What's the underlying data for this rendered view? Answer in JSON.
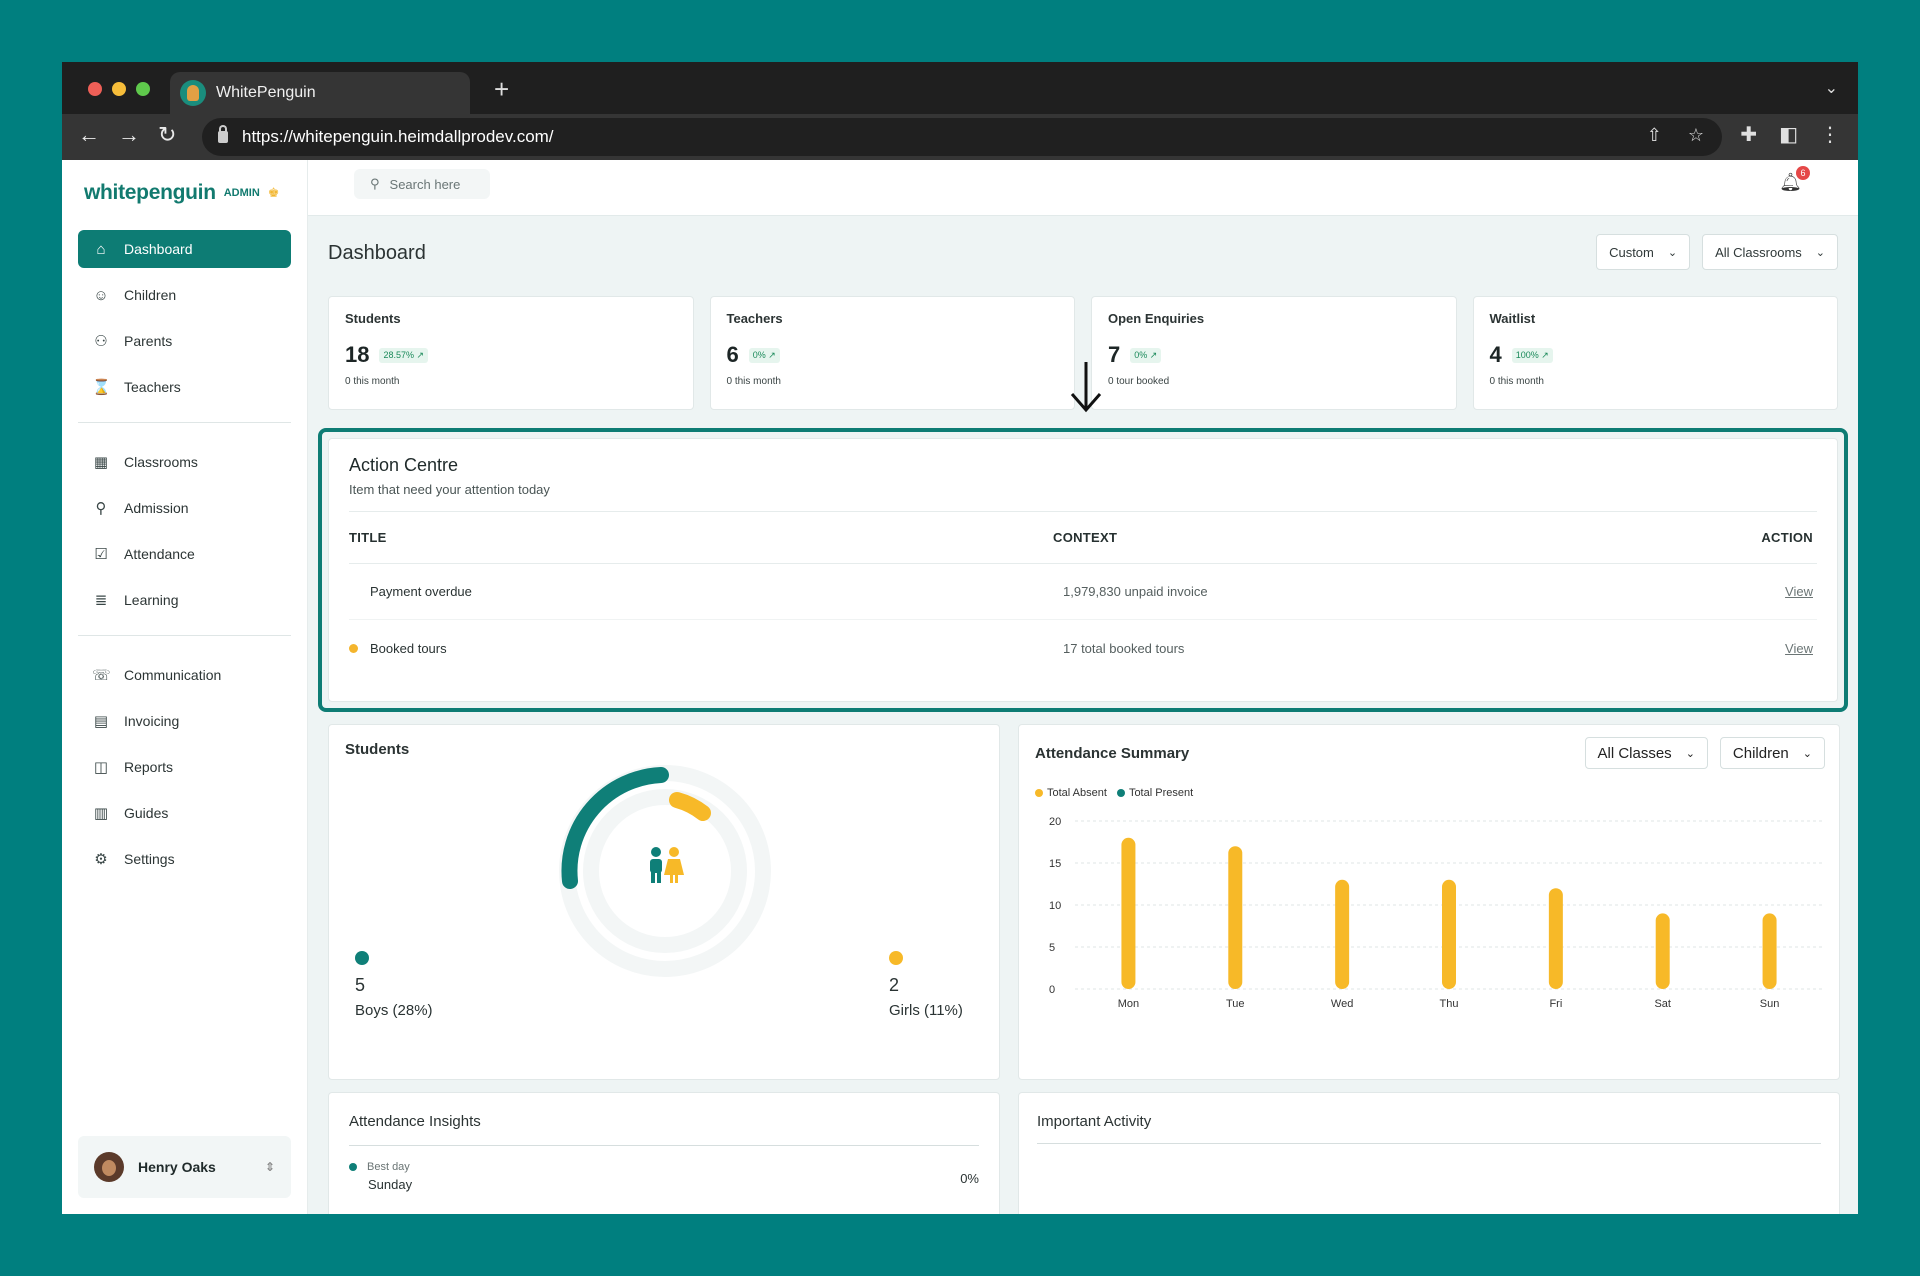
{
  "browser": {
    "tab_title": "WhitePenguin",
    "url": "https://whitepenguin.heimdallprodev.com/"
  },
  "brand": {
    "name": "whitepenguin",
    "role": "ADMIN"
  },
  "sidebar": {
    "groups": [
      [
        {
          "label": "Dashboard",
          "icon": "home-icon",
          "active": true
        },
        {
          "label": "Children",
          "icon": "child-icon"
        },
        {
          "label": "Parents",
          "icon": "parents-icon"
        },
        {
          "label": "Teachers",
          "icon": "teacher-icon"
        }
      ],
      [
        {
          "label": "Classrooms",
          "icon": "grid-icon"
        },
        {
          "label": "Admission",
          "icon": "admission-icon"
        },
        {
          "label": "Attendance",
          "icon": "check-icon"
        },
        {
          "label": "Learning",
          "icon": "learning-icon"
        }
      ],
      [
        {
          "label": "Communication",
          "icon": "chat-icon"
        },
        {
          "label": "Invoicing",
          "icon": "invoice-icon"
        },
        {
          "label": "Reports",
          "icon": "reports-icon"
        },
        {
          "label": "Guides",
          "icon": "guides-icon"
        },
        {
          "label": "Settings",
          "icon": "gear-icon"
        }
      ]
    ],
    "user": {
      "name": "Henry Oaks"
    }
  },
  "topbar": {
    "search_placeholder": "Search here",
    "notifications": "6"
  },
  "page": {
    "title": "Dashboard",
    "filters": {
      "period": "Custom",
      "classrooms": "All Classrooms"
    }
  },
  "stats": [
    {
      "label": "Students",
      "value": "18",
      "change": "28.57% ↗",
      "sub": "0 this month"
    },
    {
      "label": "Teachers",
      "value": "6",
      "change": "0% ↗",
      "sub": "0 this month"
    },
    {
      "label": "Open Enquiries",
      "value": "7",
      "change": "0% ↗",
      "sub": "0 tour booked"
    },
    {
      "label": "Waitlist",
      "value": "4",
      "change": "100% ↗",
      "sub": "0 this month"
    }
  ],
  "action_centre": {
    "title": "Action Centre",
    "subtitle": "Item that need your attention today",
    "columns": [
      "TITLE",
      "CONTEXT",
      "ACTION"
    ],
    "rows": [
      {
        "title": "Payment overdue",
        "context": "1,979,830 unpaid invoice",
        "action": "View",
        "dot": ""
      },
      {
        "title": "Booked tours",
        "context": "17 total booked tours",
        "action": "View",
        "dot": "#f4b52d"
      }
    ]
  },
  "students_card": {
    "title": "Students",
    "boys": {
      "value": "5",
      "label": "Boys (28%)"
    },
    "girls": {
      "value": "2",
      "label": "Girls (11%)"
    }
  },
  "attendance": {
    "title": "Attendance Summary",
    "filter_class": "All Classes",
    "filter_type": "Children",
    "legend_absent": "Total Absent",
    "legend_present": "Total Present"
  },
  "chart_data": {
    "type": "bar",
    "categories": [
      "Mon",
      "Tue",
      "Wed",
      "Thu",
      "Fri",
      "Sat",
      "Sun"
    ],
    "series": [
      {
        "name": "Total Absent",
        "values": [
          18,
          17,
          13,
          13,
          12,
          9,
          9
        ],
        "color": "#f7b928"
      },
      {
        "name": "Total Present",
        "values": [
          0,
          0,
          0,
          0,
          0,
          0,
          0
        ],
        "color": "#0f7f78"
      }
    ],
    "ylim": [
      0,
      20
    ],
    "yticks": [
      0,
      5,
      10,
      15,
      20
    ],
    "grid": true,
    "legend": "top-left"
  },
  "insights": {
    "title": "Attendance Insights",
    "best_day_caption": "Best day",
    "best_day": "Sunday",
    "best_day_value": "0%"
  },
  "activity": {
    "title": "Important Activity"
  },
  "colors": {
    "accent": "#0d7c74",
    "absent": "#f7b928",
    "present": "#0f7f78"
  }
}
